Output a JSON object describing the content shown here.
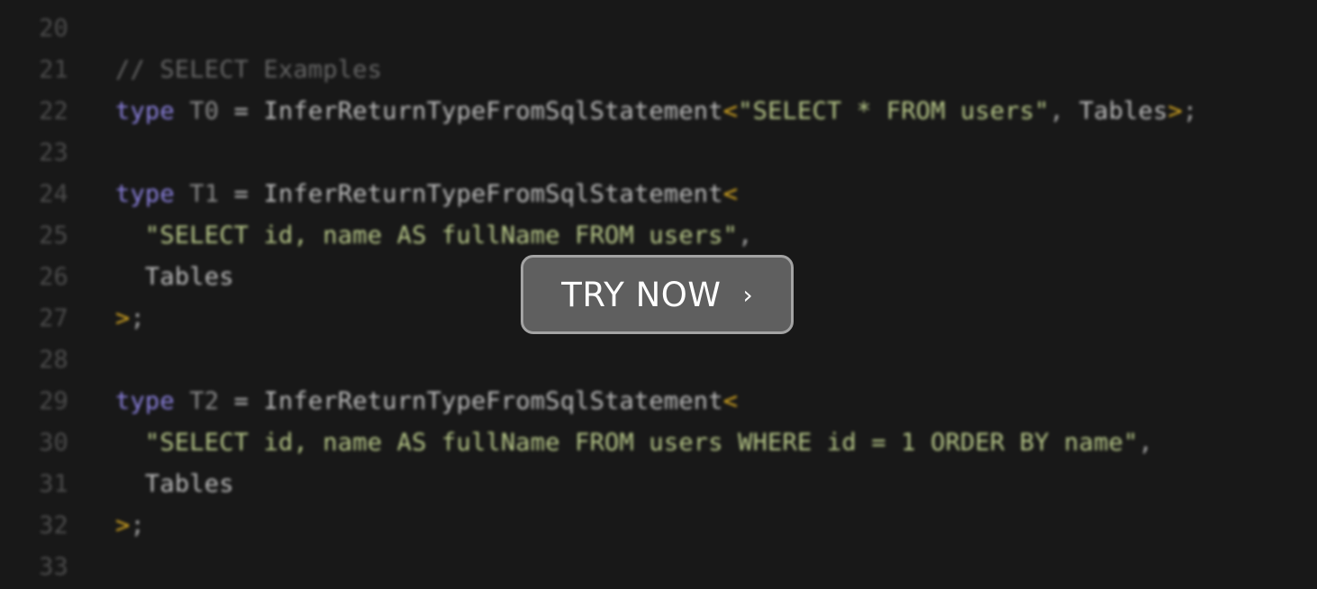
{
  "editor": {
    "lines": [
      {
        "number": "20",
        "tokens": []
      },
      {
        "number": "21",
        "tokens": [
          {
            "cls": "t-cm",
            "text": "// SELECT Examples"
          }
        ]
      },
      {
        "number": "22",
        "tokens": [
          {
            "cls": "t-kw",
            "text": "type"
          },
          {
            "cls": "t-op",
            "text": " "
          },
          {
            "cls": "t-id",
            "text": "T0"
          },
          {
            "cls": "t-op",
            "text": " = "
          },
          {
            "cls": "t-fn",
            "text": "InferReturnTypeFromSqlStatement"
          },
          {
            "cls": "t-br",
            "text": "<"
          },
          {
            "cls": "t-str",
            "text": "\"SELECT * FROM users\""
          },
          {
            "cls": "t-pun",
            "text": ", "
          },
          {
            "cls": "t-fn",
            "text": "Tables"
          },
          {
            "cls": "t-br",
            "text": ">"
          },
          {
            "cls": "t-pun",
            "text": ";"
          }
        ]
      },
      {
        "number": "23",
        "tokens": []
      },
      {
        "number": "24",
        "tokens": [
          {
            "cls": "t-kw",
            "text": "type"
          },
          {
            "cls": "t-op",
            "text": " "
          },
          {
            "cls": "t-id",
            "text": "T1"
          },
          {
            "cls": "t-op",
            "text": " = "
          },
          {
            "cls": "t-fn",
            "text": "InferReturnTypeFromSqlStatement"
          },
          {
            "cls": "t-br",
            "text": "<"
          }
        ]
      },
      {
        "number": "25",
        "tokens": [
          {
            "cls": "t-op",
            "text": "  "
          },
          {
            "cls": "t-str",
            "text": "\"SELECT id, name AS fullName FROM users\""
          },
          {
            "cls": "t-pun",
            "text": ","
          }
        ]
      },
      {
        "number": "26",
        "tokens": [
          {
            "cls": "t-op",
            "text": "  "
          },
          {
            "cls": "t-fn",
            "text": "Tables"
          }
        ]
      },
      {
        "number": "27",
        "tokens": [
          {
            "cls": "t-br",
            "text": ">"
          },
          {
            "cls": "t-pun",
            "text": ";"
          }
        ]
      },
      {
        "number": "28",
        "tokens": []
      },
      {
        "number": "29",
        "tokens": [
          {
            "cls": "t-kw",
            "text": "type"
          },
          {
            "cls": "t-op",
            "text": " "
          },
          {
            "cls": "t-id",
            "text": "T2"
          },
          {
            "cls": "t-op",
            "text": " = "
          },
          {
            "cls": "t-fn",
            "text": "InferReturnTypeFromSqlStatement"
          },
          {
            "cls": "t-br",
            "text": "<"
          }
        ]
      },
      {
        "number": "30",
        "tokens": [
          {
            "cls": "t-op",
            "text": "  "
          },
          {
            "cls": "t-str",
            "text": "\"SELECT id, name AS fullName FROM users WHERE id = 1 ORDER BY name\""
          },
          {
            "cls": "t-pun",
            "text": ","
          }
        ]
      },
      {
        "number": "31",
        "tokens": [
          {
            "cls": "t-op",
            "text": "  "
          },
          {
            "cls": "t-fn",
            "text": "Tables"
          }
        ]
      },
      {
        "number": "32",
        "tokens": [
          {
            "cls": "t-br",
            "text": ">"
          },
          {
            "cls": "t-pun",
            "text": ";"
          }
        ]
      },
      {
        "number": "33",
        "tokens": []
      }
    ]
  },
  "cta": {
    "label": "TRY NOW",
    "icon": "chevron-right-icon",
    "glyph": "›"
  },
  "colors": {
    "background": "#181818",
    "keyword": "#8a80dc",
    "string": "#b9c98a",
    "bracket": "#d3a521",
    "comment": "#666666",
    "button_fill": "#5f5f5f",
    "button_border": "#a3a3a3"
  }
}
